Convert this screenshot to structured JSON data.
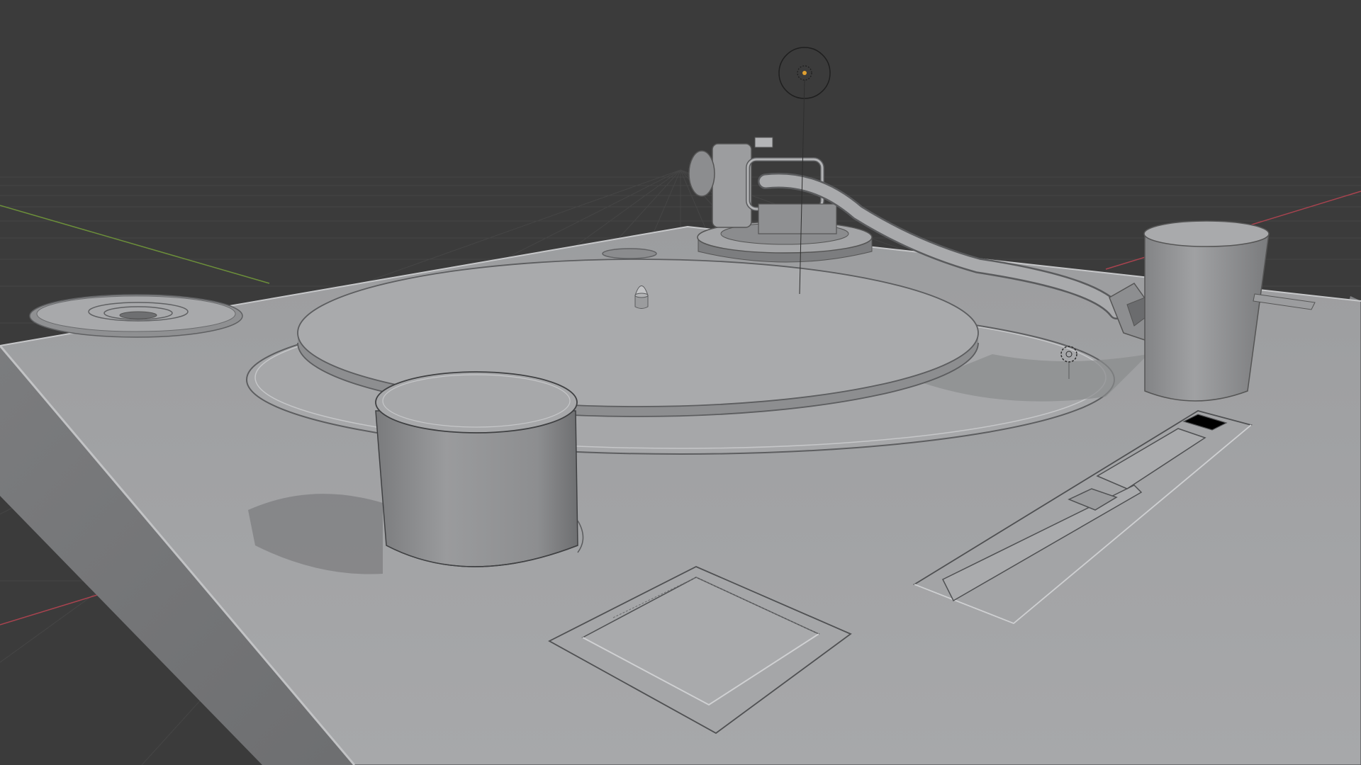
{
  "viewport": {
    "kind": "3d-viewport",
    "shading": "solid",
    "background_color": "#3b3b3b",
    "grid_color": "#454545",
    "x_axis_color": "#a8434f",
    "y_axis_color": "#6c8f3a"
  },
  "scene": {
    "object": "turntable",
    "material_color": "#a3a4a6",
    "parts": [
      "deck-base",
      "platter",
      "spindle",
      "tonearm",
      "start-stop-knob",
      "tonearm-counterweight",
      "pitch-slider-panel",
      "button-pad",
      "speed-selector",
      "light-gizmo"
    ]
  }
}
